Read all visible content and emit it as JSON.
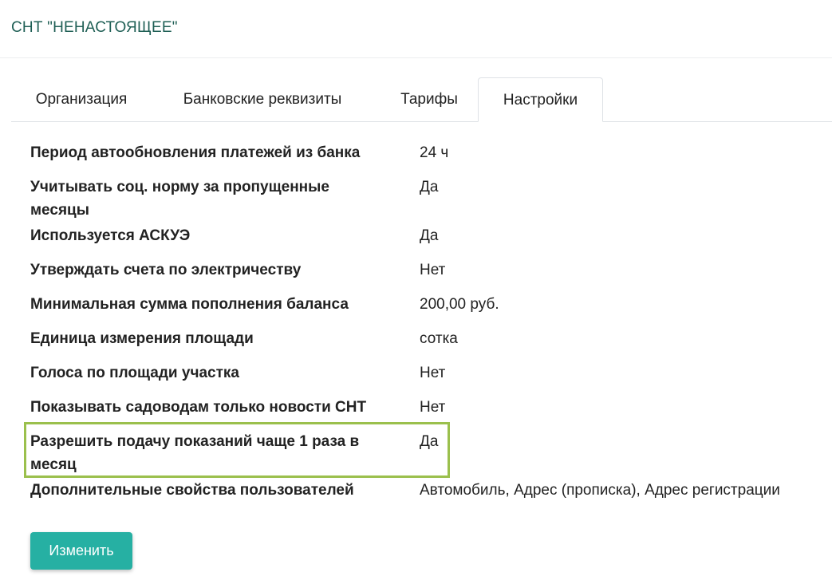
{
  "header": {
    "org_title": "СНТ \"НЕНАСТОЯЩЕЕ\""
  },
  "tabs": [
    {
      "label": "Организация",
      "active": false
    },
    {
      "label": "Банковские реквизиты",
      "active": false
    },
    {
      "label": "Тарифы",
      "active": false
    },
    {
      "label": "Настройки",
      "active": true
    }
  ],
  "settings": [
    {
      "label": "Период автообновления платежей из банка",
      "value": "24 ч"
    },
    {
      "label": "Учитывать соц. норму за пропущенные месяцы",
      "value": "Да"
    },
    {
      "label": "Используется АСКУЭ",
      "value": "Да"
    },
    {
      "label": "Утверждать счета по электричеству",
      "value": "Нет"
    },
    {
      "label": "Минимальная сумма пополнения баланса",
      "value": "200,00 руб."
    },
    {
      "label": "Единица измерения площади",
      "value": "сотка"
    },
    {
      "label": "Голоса по площади участка",
      "value": "Нет"
    },
    {
      "label": "Показывать садоводам только новости СНТ",
      "value": "Нет"
    },
    {
      "label": "Разрешить подачу показаний чаще 1 раза в месяц",
      "value": "Да"
    },
    {
      "label": "Дополнительные свойства пользователей",
      "value": "Автомобиль, Адрес (прописка), Адрес регистрации"
    }
  ],
  "actions": {
    "edit_label": "Изменить"
  },
  "colors": {
    "accent": "#26b0a3",
    "title": "#1f5f55",
    "highlight_border": "#9bc04d"
  }
}
